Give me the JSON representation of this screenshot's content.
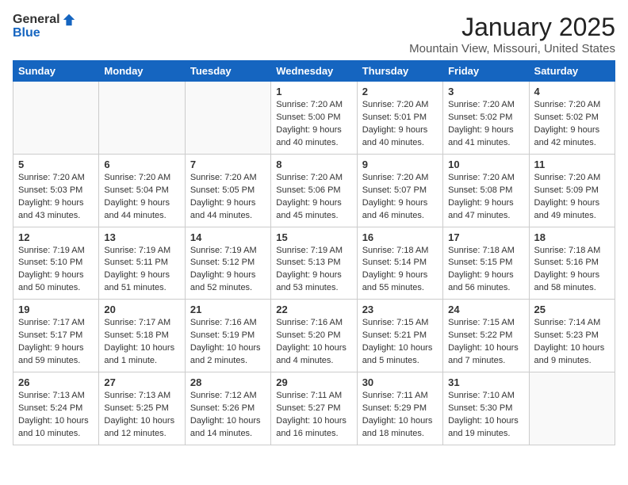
{
  "header": {
    "logo_general": "General",
    "logo_blue": "Blue",
    "month": "January 2025",
    "location": "Mountain View, Missouri, United States"
  },
  "weekdays": [
    "Sunday",
    "Monday",
    "Tuesday",
    "Wednesday",
    "Thursday",
    "Friday",
    "Saturday"
  ],
  "weeks": [
    [
      {
        "day": "",
        "info": ""
      },
      {
        "day": "",
        "info": ""
      },
      {
        "day": "",
        "info": ""
      },
      {
        "day": "1",
        "info": "Sunrise: 7:20 AM\nSunset: 5:00 PM\nDaylight: 9 hours and 40 minutes."
      },
      {
        "day": "2",
        "info": "Sunrise: 7:20 AM\nSunset: 5:01 PM\nDaylight: 9 hours and 40 minutes."
      },
      {
        "day": "3",
        "info": "Sunrise: 7:20 AM\nSunset: 5:02 PM\nDaylight: 9 hours and 41 minutes."
      },
      {
        "day": "4",
        "info": "Sunrise: 7:20 AM\nSunset: 5:02 PM\nDaylight: 9 hours and 42 minutes."
      }
    ],
    [
      {
        "day": "5",
        "info": "Sunrise: 7:20 AM\nSunset: 5:03 PM\nDaylight: 9 hours and 43 minutes."
      },
      {
        "day": "6",
        "info": "Sunrise: 7:20 AM\nSunset: 5:04 PM\nDaylight: 9 hours and 44 minutes."
      },
      {
        "day": "7",
        "info": "Sunrise: 7:20 AM\nSunset: 5:05 PM\nDaylight: 9 hours and 44 minutes."
      },
      {
        "day": "8",
        "info": "Sunrise: 7:20 AM\nSunset: 5:06 PM\nDaylight: 9 hours and 45 minutes."
      },
      {
        "day": "9",
        "info": "Sunrise: 7:20 AM\nSunset: 5:07 PM\nDaylight: 9 hours and 46 minutes."
      },
      {
        "day": "10",
        "info": "Sunrise: 7:20 AM\nSunset: 5:08 PM\nDaylight: 9 hours and 47 minutes."
      },
      {
        "day": "11",
        "info": "Sunrise: 7:20 AM\nSunset: 5:09 PM\nDaylight: 9 hours and 49 minutes."
      }
    ],
    [
      {
        "day": "12",
        "info": "Sunrise: 7:19 AM\nSunset: 5:10 PM\nDaylight: 9 hours and 50 minutes."
      },
      {
        "day": "13",
        "info": "Sunrise: 7:19 AM\nSunset: 5:11 PM\nDaylight: 9 hours and 51 minutes."
      },
      {
        "day": "14",
        "info": "Sunrise: 7:19 AM\nSunset: 5:12 PM\nDaylight: 9 hours and 52 minutes."
      },
      {
        "day": "15",
        "info": "Sunrise: 7:19 AM\nSunset: 5:13 PM\nDaylight: 9 hours and 53 minutes."
      },
      {
        "day": "16",
        "info": "Sunrise: 7:18 AM\nSunset: 5:14 PM\nDaylight: 9 hours and 55 minutes."
      },
      {
        "day": "17",
        "info": "Sunrise: 7:18 AM\nSunset: 5:15 PM\nDaylight: 9 hours and 56 minutes."
      },
      {
        "day": "18",
        "info": "Sunrise: 7:18 AM\nSunset: 5:16 PM\nDaylight: 9 hours and 58 minutes."
      }
    ],
    [
      {
        "day": "19",
        "info": "Sunrise: 7:17 AM\nSunset: 5:17 PM\nDaylight: 9 hours and 59 minutes."
      },
      {
        "day": "20",
        "info": "Sunrise: 7:17 AM\nSunset: 5:18 PM\nDaylight: 10 hours and 1 minute."
      },
      {
        "day": "21",
        "info": "Sunrise: 7:16 AM\nSunset: 5:19 PM\nDaylight: 10 hours and 2 minutes."
      },
      {
        "day": "22",
        "info": "Sunrise: 7:16 AM\nSunset: 5:20 PM\nDaylight: 10 hours and 4 minutes."
      },
      {
        "day": "23",
        "info": "Sunrise: 7:15 AM\nSunset: 5:21 PM\nDaylight: 10 hours and 5 minutes."
      },
      {
        "day": "24",
        "info": "Sunrise: 7:15 AM\nSunset: 5:22 PM\nDaylight: 10 hours and 7 minutes."
      },
      {
        "day": "25",
        "info": "Sunrise: 7:14 AM\nSunset: 5:23 PM\nDaylight: 10 hours and 9 minutes."
      }
    ],
    [
      {
        "day": "26",
        "info": "Sunrise: 7:13 AM\nSunset: 5:24 PM\nDaylight: 10 hours and 10 minutes."
      },
      {
        "day": "27",
        "info": "Sunrise: 7:13 AM\nSunset: 5:25 PM\nDaylight: 10 hours and 12 minutes."
      },
      {
        "day": "28",
        "info": "Sunrise: 7:12 AM\nSunset: 5:26 PM\nDaylight: 10 hours and 14 minutes."
      },
      {
        "day": "29",
        "info": "Sunrise: 7:11 AM\nSunset: 5:27 PM\nDaylight: 10 hours and 16 minutes."
      },
      {
        "day": "30",
        "info": "Sunrise: 7:11 AM\nSunset: 5:29 PM\nDaylight: 10 hours and 18 minutes."
      },
      {
        "day": "31",
        "info": "Sunrise: 7:10 AM\nSunset: 5:30 PM\nDaylight: 10 hours and 19 minutes."
      },
      {
        "day": "",
        "info": ""
      }
    ]
  ]
}
